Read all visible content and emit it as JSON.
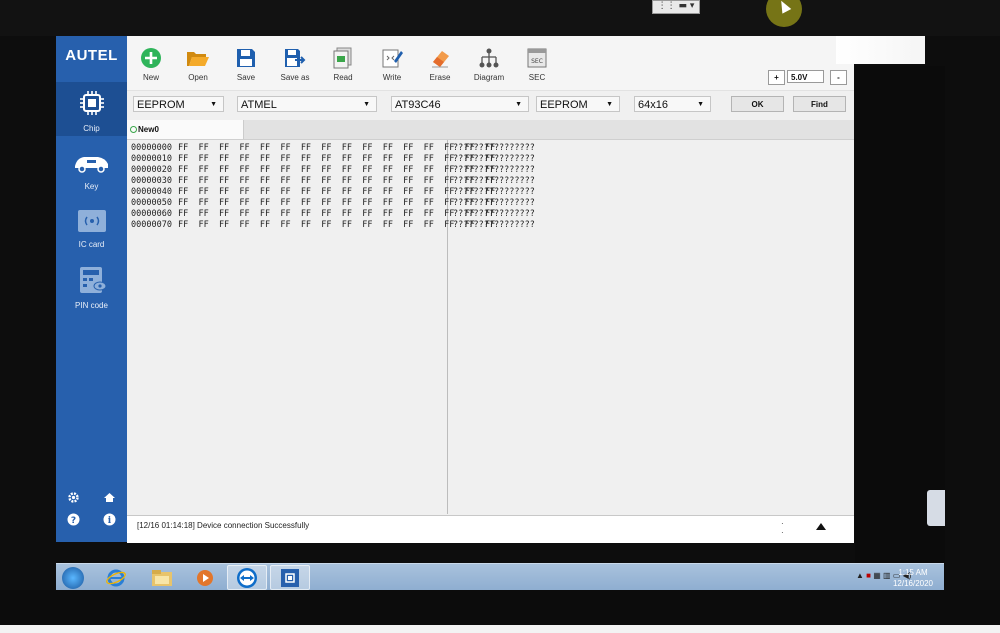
{
  "remote_widget": {
    "label": "⋮⋮ ▬ ▾"
  },
  "app": {
    "logo": "AUTEL",
    "sidebar": [
      {
        "label": "Chip",
        "icon": "chip-icon"
      },
      {
        "label": "Key",
        "icon": "car-key-icon"
      },
      {
        "label": "IC card",
        "icon": "ic-card-icon"
      },
      {
        "label": "PIN code",
        "icon": "pin-code-icon"
      }
    ],
    "toolbar": [
      {
        "label": "New",
        "icon": "add-icon"
      },
      {
        "label": "Open",
        "icon": "folder-open-icon"
      },
      {
        "label": "Save",
        "icon": "save-icon"
      },
      {
        "label": "Save as",
        "icon": "save-as-icon"
      },
      {
        "label": "Read",
        "icon": "read-icon"
      },
      {
        "label": "Write",
        "icon": "write-icon"
      },
      {
        "label": "Erase",
        "icon": "erase-icon"
      },
      {
        "label": "Diagram",
        "icon": "diagram-icon"
      },
      {
        "label": "SEC",
        "icon": "sec-icon"
      }
    ],
    "voltage": {
      "plus": "+",
      "value": "5.0V",
      "minus": "-"
    },
    "dropdowns": [
      {
        "value": "EEPROM"
      },
      {
        "value": "ATMEL"
      },
      {
        "value": "AT93C46"
      },
      {
        "value": "EEPROM"
      },
      {
        "value": "64x16"
      }
    ],
    "buttons": {
      "ok": "OK",
      "find": "Find"
    },
    "tab": {
      "label": "New0"
    },
    "hex_rows": [
      {
        "addr": "00000000",
        "bytes": "FF  FF  FF  FF  FF  FF  FF  FF  FF  FF  FF  FF  FF  FF  FF  FF",
        "ascii": "????????????????"
      },
      {
        "addr": "00000010",
        "bytes": "FF  FF  FF  FF  FF  FF  FF  FF  FF  FF  FF  FF  FF  FF  FF  FF",
        "ascii": "????????????????"
      },
      {
        "addr": "00000020",
        "bytes": "FF  FF  FF  FF  FF  FF  FF  FF  FF  FF  FF  FF  FF  FF  FF  FF",
        "ascii": "????????????????"
      },
      {
        "addr": "00000030",
        "bytes": "FF  FF  FF  FF  FF  FF  FF  FF  FF  FF  FF  FF  FF  FF  FF  FF",
        "ascii": "????????????????"
      },
      {
        "addr": "00000040",
        "bytes": "FF  FF  FF  FF  FF  FF  FF  FF  FF  FF  FF  FF  FF  FF  FF  FF",
        "ascii": "????????????????"
      },
      {
        "addr": "00000050",
        "bytes": "FF  FF  FF  FF  FF  FF  FF  FF  FF  FF  FF  FF  FF  FF  FF  FF",
        "ascii": "????????????????"
      },
      {
        "addr": "00000060",
        "bytes": "FF  FF  FF  FF  FF  FF  FF  FF  FF  FF  FF  FF  FF  FF  FF  FF",
        "ascii": "????????????????"
      },
      {
        "addr": "00000070",
        "bytes": "FF  FF  FF  FF  FF  FF  FF  FF  FF  FF  FF  FF  FF  FF  FF  FF",
        "ascii": "????????????????"
      }
    ],
    "status": {
      "message": "[12/16 01:14:18] Device connection Successfully"
    }
  },
  "taskbar": {
    "time": "1:15 AM",
    "date": "12/16/2020"
  },
  "colors": {
    "sidebar": "#2760ad",
    "accent_green": "#2fb45a",
    "toolbar_blue": "#2b6cb5"
  }
}
